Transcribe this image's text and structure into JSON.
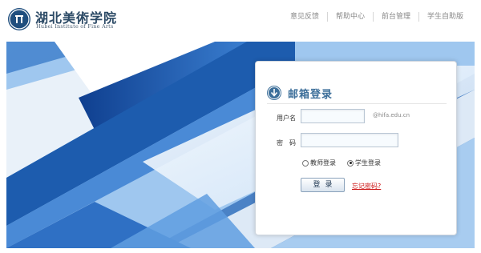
{
  "header": {
    "logo_cn": "湖北美術学院",
    "logo_en": "Hubei Institute of Fine Arts",
    "nav": [
      "意见反馈",
      "帮助中心",
      "前台管理",
      "学生自助版"
    ]
  },
  "login": {
    "title": "邮箱登录",
    "username_label": "用户名",
    "username_value": "",
    "domain": "@hifa.edu.cn",
    "password_label": "密　码",
    "password_value": "",
    "radio_options": [
      {
        "label": "教师登录",
        "checked": false
      },
      {
        "label": "学生登录",
        "checked": true
      }
    ],
    "submit_label": "登录",
    "forgot_link": "忘记密码?"
  },
  "colors": {
    "brand": "#1f4e7e",
    "title": "#3d6f9a",
    "link": "#cc1111"
  },
  "icons": {
    "logo": "college-emblem",
    "login": "down-arrow-icon"
  }
}
